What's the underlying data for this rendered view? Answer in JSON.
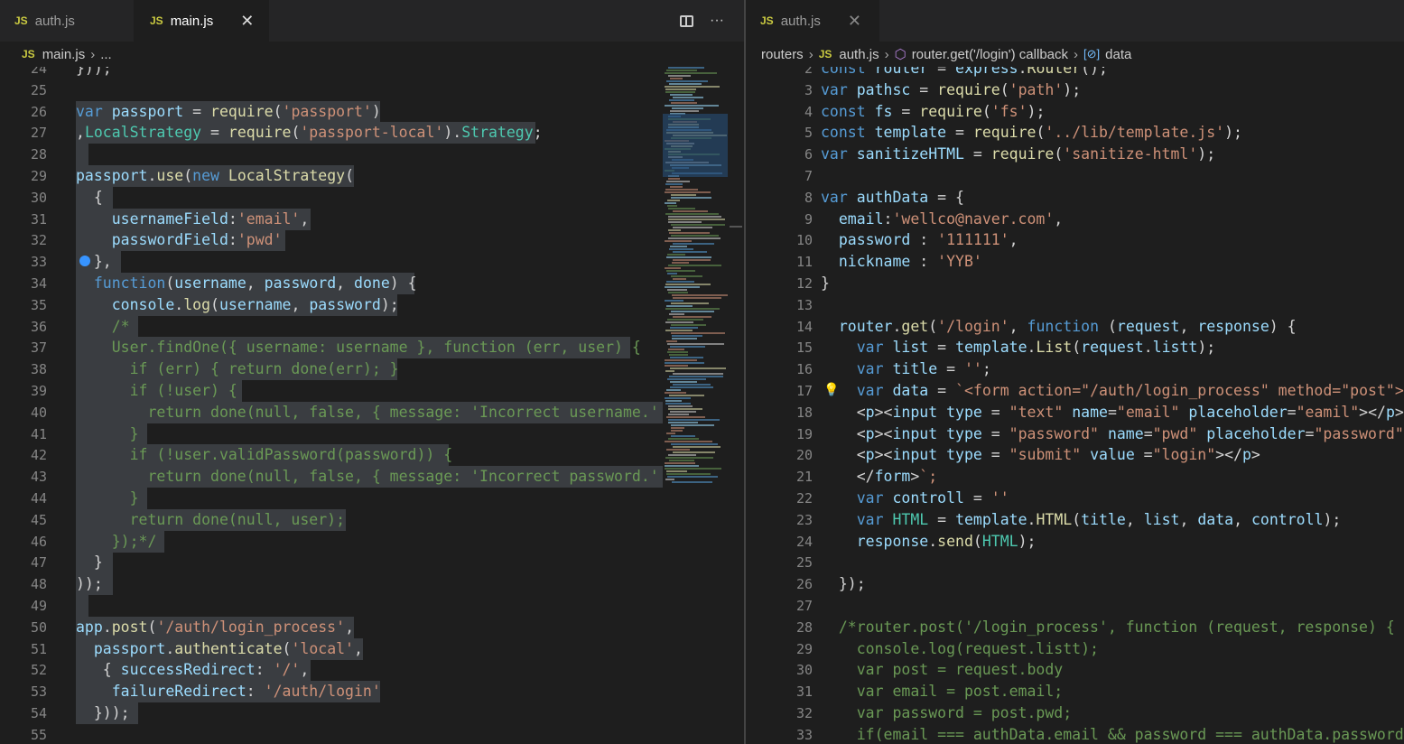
{
  "left": {
    "tabs": [
      {
        "badge": "JS",
        "label": "auth.js"
      },
      {
        "badge": "JS",
        "label": "main.js",
        "close": "✕"
      }
    ],
    "actions": {
      "more": "···"
    },
    "breadcrumb": {
      "badge": "JS",
      "file": "main.js",
      "rest": "..."
    },
    "lines": [
      {
        "n": "24",
        "t": "}));"
      },
      {
        "n": "25",
        "t": ""
      },
      {
        "n": "26",
        "t": "var passport = require('passport')"
      },
      {
        "n": "27",
        "t": ",LocalStrategy = require('passport-local').Strategy;"
      },
      {
        "n": "28",
        "t": ""
      },
      {
        "n": "29",
        "t": "passport.use(new LocalStrategy("
      },
      {
        "n": "30",
        "t": "  {"
      },
      {
        "n": "31",
        "t": "    usernameField:'email',"
      },
      {
        "n": "32",
        "t": "    passwordField:'pwd'"
      },
      {
        "n": "33",
        "t": "  },"
      },
      {
        "n": "34",
        "t": "  function(username, password, done) {"
      },
      {
        "n": "35",
        "t": "    console.log(username, password);"
      },
      {
        "n": "36",
        "t": "    /*"
      },
      {
        "n": "37",
        "t": "    User.findOne({ username: username }, function (err, user) {"
      },
      {
        "n": "38",
        "t": "      if (err) { return done(err); }"
      },
      {
        "n": "39",
        "t": "      if (!user) {"
      },
      {
        "n": "40",
        "t": "        return done(null, false, { message: 'Incorrect username.' });"
      },
      {
        "n": "41",
        "t": "      }"
      },
      {
        "n": "42",
        "t": "      if (!user.validPassword(password)) {"
      },
      {
        "n": "43",
        "t": "        return done(null, false, { message: 'Incorrect password.' });"
      },
      {
        "n": "44",
        "t": "      }"
      },
      {
        "n": "45",
        "t": "      return done(null, user);"
      },
      {
        "n": "46",
        "t": "    });*/"
      },
      {
        "n": "47",
        "t": "  }"
      },
      {
        "n": "48",
        "t": "));"
      },
      {
        "n": "49",
        "t": ""
      },
      {
        "n": "50",
        "t": "app.post('/auth/login_process',"
      },
      {
        "n": "51",
        "t": "  passport.authenticate('local',"
      },
      {
        "n": "52",
        "t": "   { successRedirect: '/',"
      },
      {
        "n": "53",
        "t": "    failureRedirect: '/auth/login'"
      },
      {
        "n": "54",
        "t": "  }));"
      },
      {
        "n": "55",
        "t": ""
      }
    ]
  },
  "right": {
    "tabs": [
      {
        "badge": "JS",
        "label": "auth.js",
        "close": "✕"
      }
    ],
    "breadcrumb": {
      "folder": "routers",
      "badge": "JS",
      "file": "auth.js",
      "fn": "router.get('/login') callback",
      "var": "data"
    },
    "lines": [
      {
        "n": "2",
        "t": "const router = express.Router();"
      },
      {
        "n": "3",
        "t": "var pathsc = require('path');"
      },
      {
        "n": "4",
        "t": "const fs = require('fs');"
      },
      {
        "n": "5",
        "t": "const template = require('../lib/template.js');"
      },
      {
        "n": "6",
        "t": "var sanitizeHTML = require('sanitize-html');"
      },
      {
        "n": "7",
        "t": ""
      },
      {
        "n": "8",
        "t": "var authData = {"
      },
      {
        "n": "9",
        "t": "  email:'wellco@naver.com',"
      },
      {
        "n": "10",
        "t": "  password : '111111',"
      },
      {
        "n": "11",
        "t": "  nickname : 'YYB'"
      },
      {
        "n": "12",
        "t": "}"
      },
      {
        "n": "13",
        "t": ""
      },
      {
        "n": "14",
        "t": "  router.get('/login', function (request, response) {"
      },
      {
        "n": "15",
        "t": "    var list = template.List(request.listt);"
      },
      {
        "n": "16",
        "t": "    var title = '';"
      },
      {
        "n": "17",
        "t": "    var data = `<form action=\"/auth/login_process\" method=\"post\">"
      },
      {
        "n": "18",
        "t": "    <p><input type = \"text\" name=\"email\" placeholder=\"eamil\"></p>"
      },
      {
        "n": "19",
        "t": "    <p><input type = \"password\" name=\"pwd\" placeholder=\"password\"></p>"
      },
      {
        "n": "20",
        "t": "    <p><input type = \"submit\" value =\"login\"></p>"
      },
      {
        "n": "21",
        "t": "    </form>`;"
      },
      {
        "n": "22",
        "t": "    var controll = ''"
      },
      {
        "n": "23",
        "t": "    var HTML = template.HTML(title, list, data, controll);"
      },
      {
        "n": "24",
        "t": "    response.send(HTML);"
      },
      {
        "n": "25",
        "t": ""
      },
      {
        "n": "26",
        "t": "  });"
      },
      {
        "n": "27",
        "t": ""
      },
      {
        "n": "28",
        "t": "  /*router.post('/login_process', function (request, response) {"
      },
      {
        "n": "29",
        "t": "    console.log(request.listt);"
      },
      {
        "n": "30",
        "t": "    var post = request.body"
      },
      {
        "n": "31",
        "t": "    var email = post.email;"
      },
      {
        "n": "32",
        "t": "    var password = post.pwd;"
      },
      {
        "n": "33",
        "t": "    if(email === authData.email && password === authData.password){"
      }
    ]
  }
}
